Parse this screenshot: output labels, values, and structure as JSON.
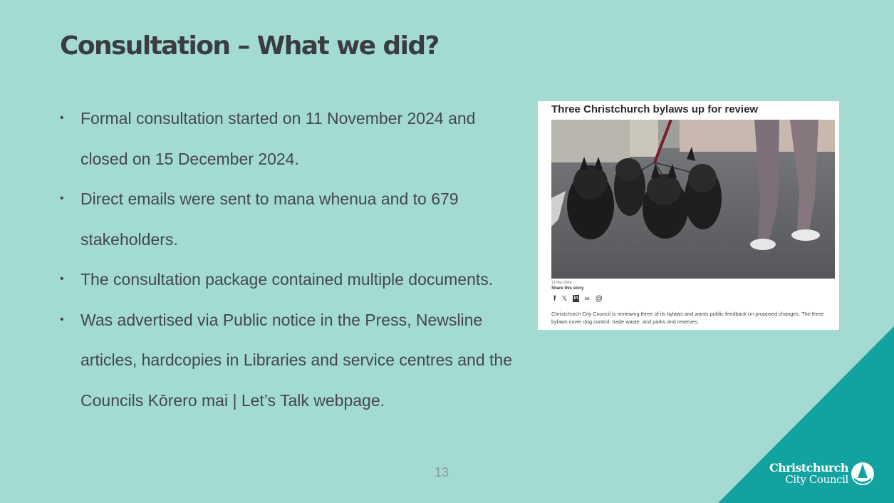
{
  "slide": {
    "title": "Consultation – What we did?",
    "bullet_marker": "•",
    "bullets": [
      "Formal consultation started on 11 November 2024 and closed on 15 December 2024.",
      "Direct emails were sent to mana whenua and to 679 stakeholders.",
      "The consultation package contained multiple documents.",
      "Was advertised via Public notice in the Press, Newsline articles, hardcopies in Libraries and service centres and the Councils Kōrero mai | Let’s Talk webpage."
    ],
    "page_number": "13"
  },
  "news_card": {
    "headline": "Three Christchurch bylaws up for review",
    "date": "12 Nov 2024",
    "share_label": "Share this story",
    "share_icons": [
      "facebook-icon",
      "x-icon",
      "linkedin-icon",
      "link-icon",
      "email-icon"
    ],
    "share_glyphs": [
      "f",
      "𝕏",
      "in",
      "∞",
      "@"
    ],
    "body": "Christchurch City Council is reviewing three of its bylaws and wants public feedback on proposed changes. The three bylaws cover dog control, trade waste, and parks and reserves."
  },
  "logo": {
    "line1": "Christchurch",
    "line2": "City Council"
  },
  "colors": {
    "background": "#a3dbd3",
    "corner": "#12a3a0",
    "title": "#3a3d3f",
    "body_text": "#444749"
  }
}
